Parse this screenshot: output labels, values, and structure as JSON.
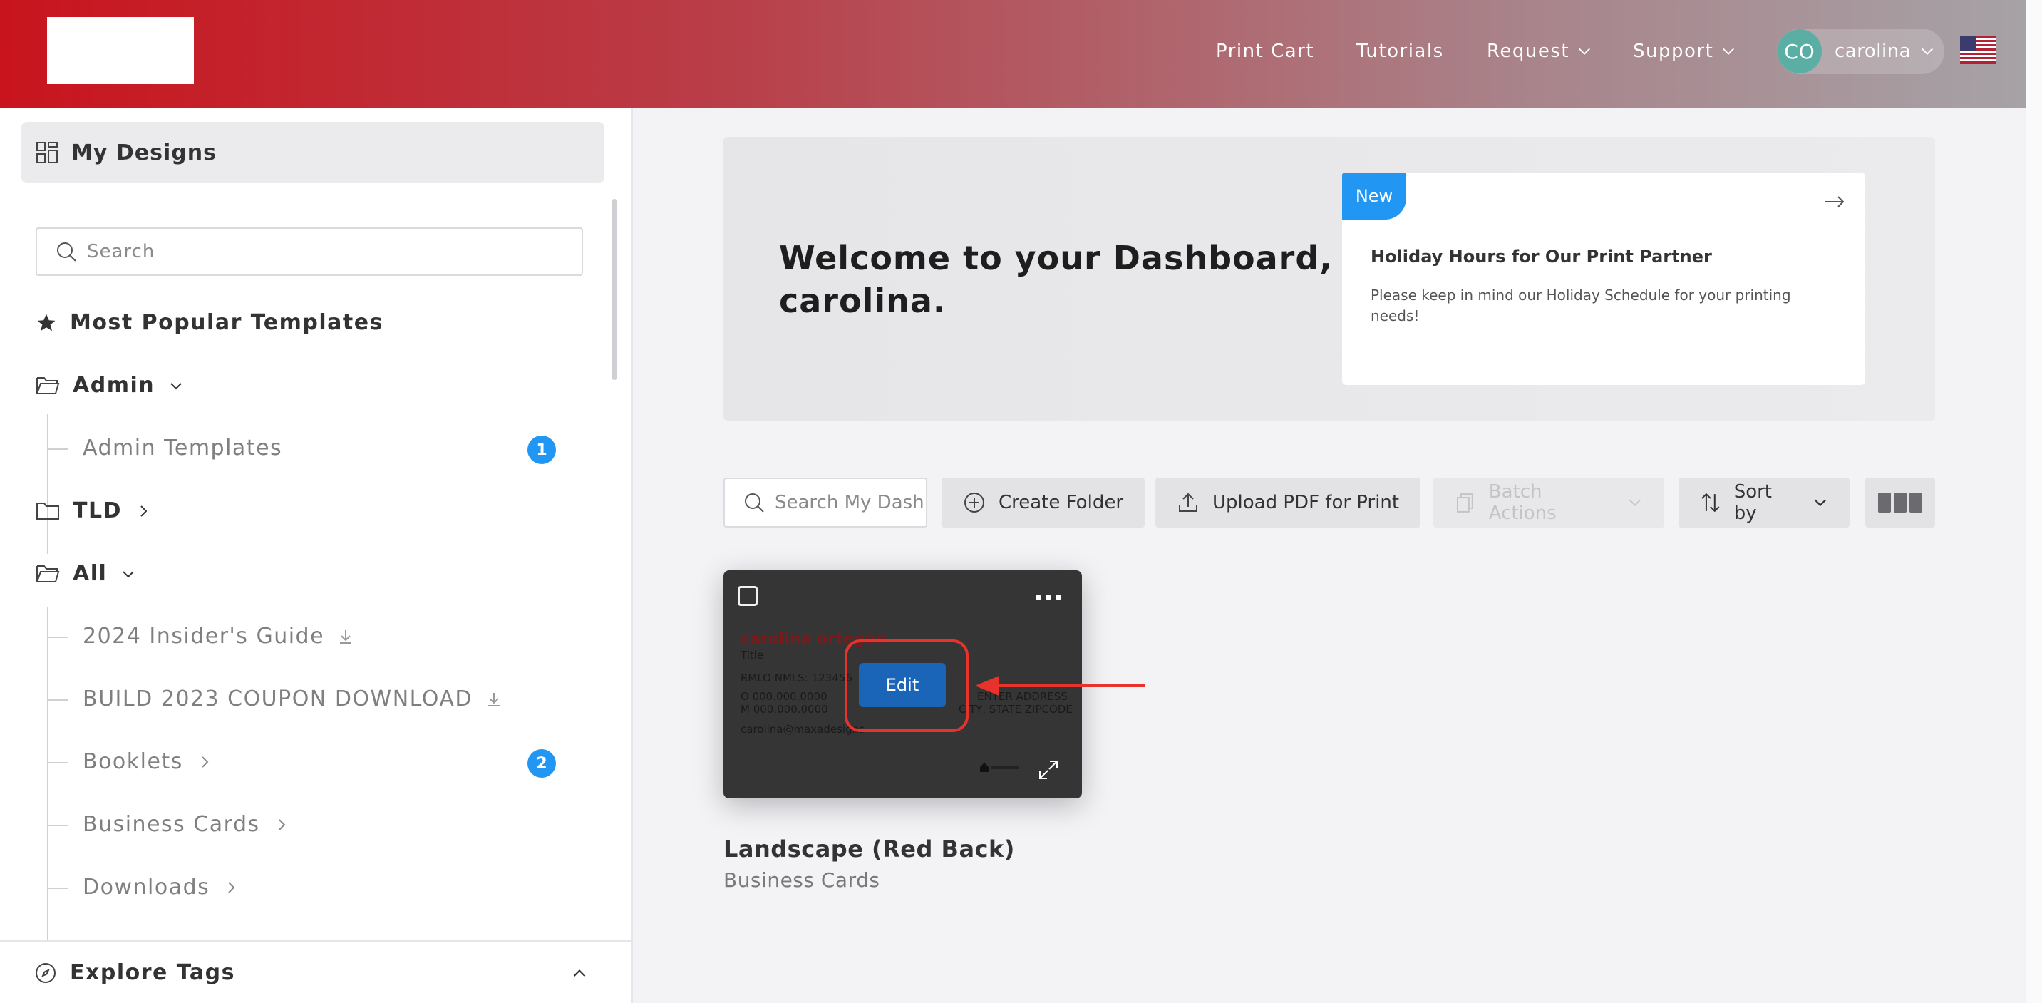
{
  "nav": {
    "items": [
      {
        "label": "Print Cart",
        "dropdown": false
      },
      {
        "label": "Tutorials",
        "dropdown": false
      },
      {
        "label": "Request",
        "dropdown": true
      },
      {
        "label": "Support",
        "dropdown": true
      }
    ],
    "user": {
      "initials": "CO",
      "name": "carolina"
    },
    "locale_flag": "us-flag-icon"
  },
  "sidebar": {
    "my_designs": "My Designs",
    "search_placeholder": "Search",
    "most_popular": "Most Popular Templates",
    "folders": [
      {
        "label": "Admin",
        "expanded": true
      },
      {
        "label": "Admin Templates",
        "badge": "1"
      },
      {
        "label": "TLD",
        "expanded": false
      },
      {
        "label": "All",
        "expanded": true
      },
      {
        "label": "2024 Insider's Guide",
        "icon": "download-icon"
      },
      {
        "label": "BUILD 2023 COUPON DOWNLOAD",
        "icon": "download-icon"
      },
      {
        "label": "Booklets",
        "badge": "2"
      },
      {
        "label": "Business Cards"
      },
      {
        "label": "Downloads"
      }
    ],
    "explore_tags": "Explore Tags"
  },
  "welcome": {
    "title": "Welcome to your Dashboard, carolina.",
    "news": {
      "tag": "New",
      "title": "Holiday Hours for Our Print Partner",
      "body": "Please keep in mind our Holiday Schedule for your printing needs!"
    }
  },
  "toolbar": {
    "search_placeholder": "Search My Dashboard",
    "create_folder": "Create Folder",
    "upload_pdf": "Upload PDF for Print",
    "batch_actions": "Batch Actions",
    "sort_by": "Sort by"
  },
  "design": {
    "title": "Landscape (Red Back)",
    "category": "Business Cards",
    "edit_label": "Edit",
    "preview": {
      "name": "carolina ortegon",
      "title": "Title",
      "nmls": "RMLO NMLS: 123456",
      "office": "O  000.000.0000",
      "mobile": "M  000.000.0000",
      "email": "carolina@maxadesigns",
      "address1": "ENTER ADDRESS",
      "address2": "CITY, STATE ZIPCODE"
    }
  },
  "colors": {
    "brand_red": "#c9141d",
    "accent_blue": "#2196f3",
    "edit_blue": "#1b65b9",
    "annotation_red": "#e8332d"
  }
}
